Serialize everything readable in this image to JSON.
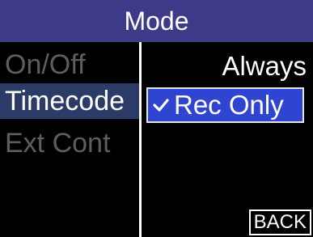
{
  "header": {
    "title": "Mode"
  },
  "menu": {
    "items": [
      {
        "label": "On/Off",
        "active": false
      },
      {
        "label": "Timecode",
        "active": true
      },
      {
        "label": "Ext Cont",
        "active": false
      }
    ]
  },
  "options": {
    "items": [
      {
        "label": "Always",
        "selected": false
      },
      {
        "label": "Rec Only",
        "selected": true,
        "icon": "checkmark-icon"
      }
    ]
  },
  "footer": {
    "back_label": "BACK"
  },
  "colors": {
    "title_bar": "#3d3a8a",
    "active_menu": "#2b3a66",
    "selected_option": "#2f45d2",
    "inactive_text": "#5e5e5e",
    "text": "#ffffff",
    "background": "#000000"
  }
}
